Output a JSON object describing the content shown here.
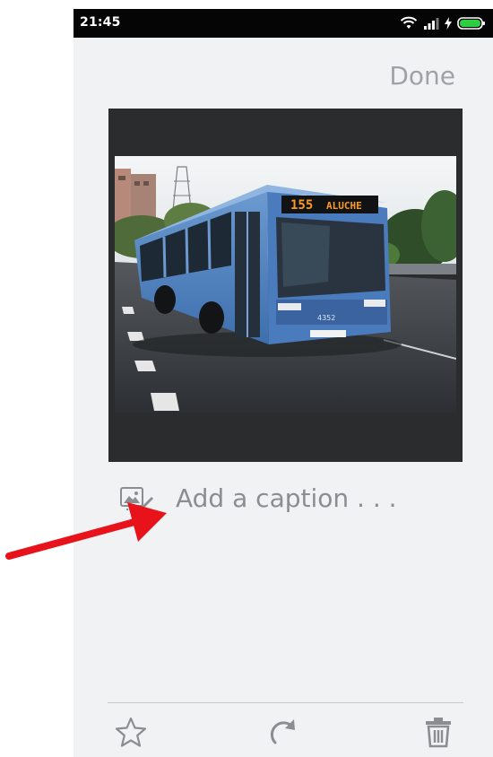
{
  "status_bar": {
    "time": "21:45",
    "icons": [
      "wifi-icon",
      "signal-icon",
      "charging-icon",
      "battery-icon"
    ],
    "battery_color": "#2ecc40"
  },
  "header": {
    "done_label": "Done"
  },
  "photo": {
    "subject": "bus-photo",
    "bus_route_display": "155",
    "bus_destination_display": "ALUCHE"
  },
  "caption": {
    "placeholder": "Add a caption . . .",
    "value": "",
    "icon": "image-edit-icon"
  },
  "toolbar": {
    "icons": [
      "star-icon",
      "rotate-icon",
      "trash-icon"
    ]
  },
  "annotation": {
    "arrow_color": "#e8121a"
  }
}
